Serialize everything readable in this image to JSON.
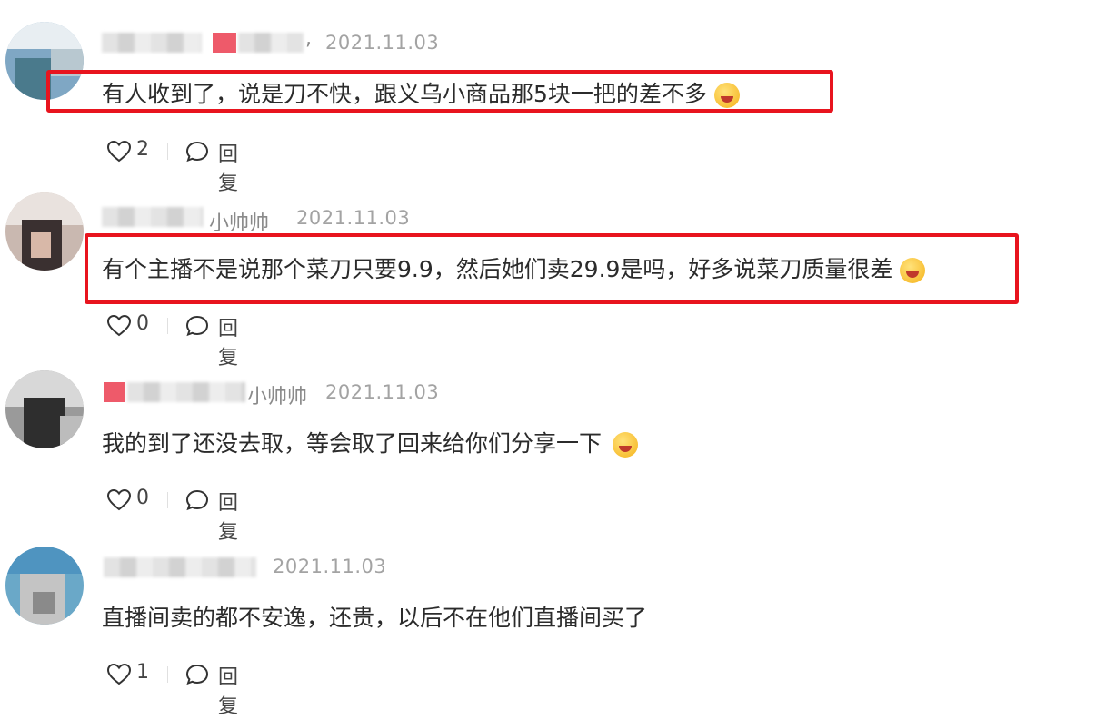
{
  "comments": [
    {
      "name_suffix": ",",
      "date": "2021.11.03",
      "text": "有人收到了，说是刀不快，跟义乌小商品那5块一把的差不多",
      "emoji": "face-tears-of-joy",
      "likes": "2",
      "reply_label": "回复",
      "highlighted": true
    },
    {
      "name_suffix": "小帅帅",
      "date": "2021.11.03",
      "text": "有个主播不是说那个菜刀只要9.9，然后她们卖29.9是吗，好多说菜刀质量很差",
      "emoji": "face-tears-of-joy",
      "likes": "0",
      "reply_label": "回复",
      "highlighted": true
    },
    {
      "name_suffix": "小帅帅",
      "date": "2021.11.03",
      "text": "我的到了还没去取，等会取了回来给你们分享一下",
      "emoji": "grinning-face",
      "likes": "0",
      "reply_label": "回复",
      "highlighted": false
    },
    {
      "name_suffix": "",
      "date": "2021.11.03",
      "text": "直播间卖的都不安逸，还贵，以后不在他们直播间买了",
      "emoji": "",
      "likes": "1",
      "reply_label": "回复",
      "highlighted": false
    }
  ],
  "colors": {
    "highlight_border": "#e8141e",
    "text": "#2b2b2b",
    "date": "#a3a3a3"
  }
}
